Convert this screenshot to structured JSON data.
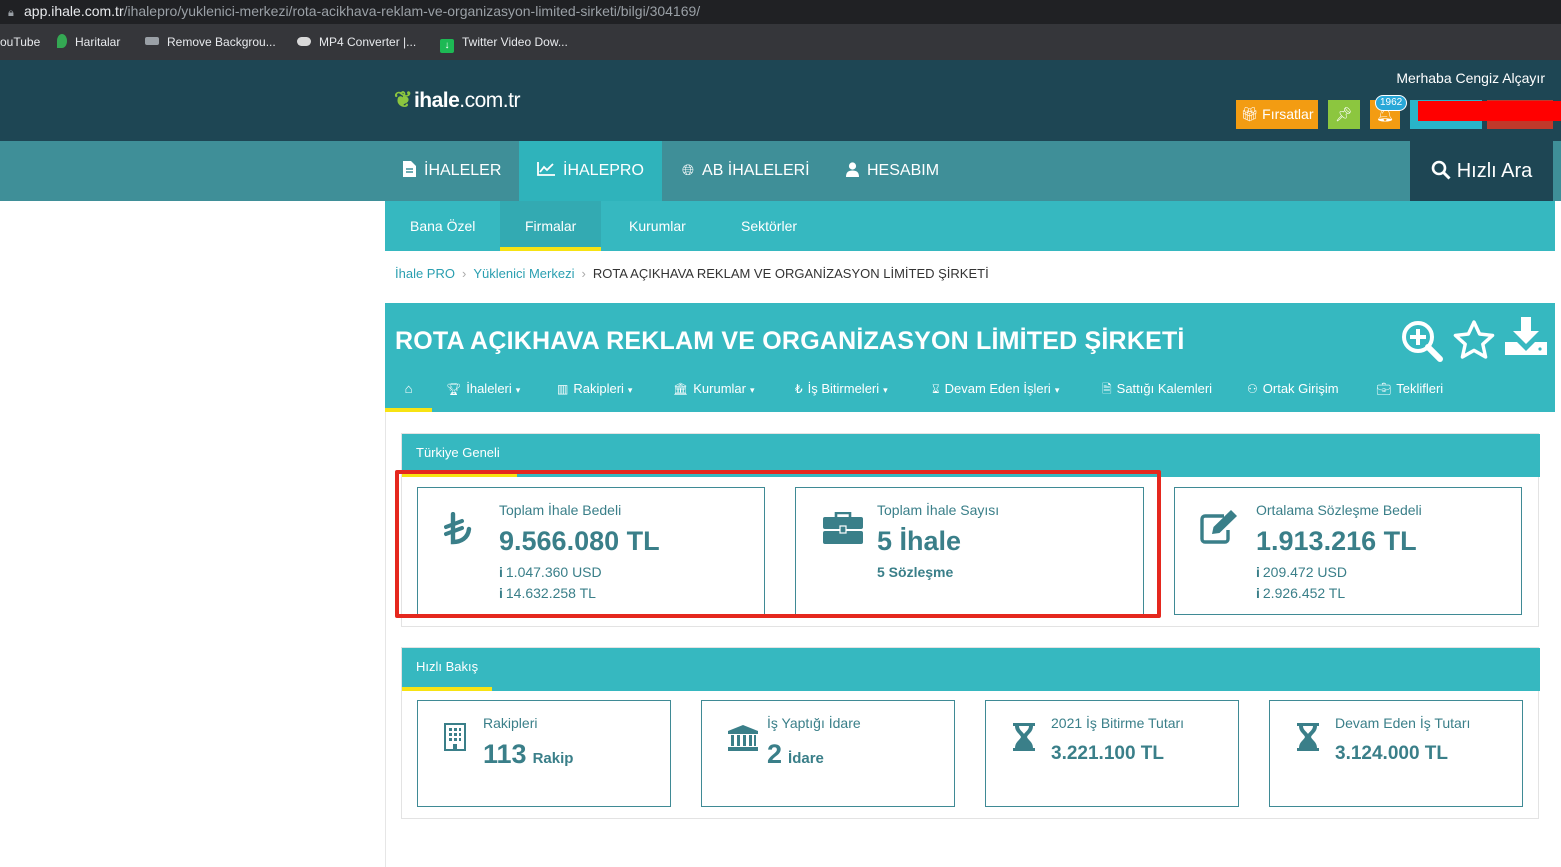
{
  "browser": {
    "url_host": "app.ihale.com.tr",
    "url_path": "/ihalepro/yuklenici-merkezi/rota-acikhava-reklam-ve-organizasyon-limited-sirketi/bilgi/304169/",
    "bookmarks": [
      "ouTube",
      "Haritalar",
      "Remove Backgrou...",
      "MP4 Converter |...",
      "Twitter Video Dow..."
    ]
  },
  "header": {
    "logo_main": "ihale",
    "logo_domain": ".com.tr",
    "greeting": "Merhaba Cengiz Alçayır",
    "firsatlar_label": "Fırsatlar",
    "notification_count": "1962"
  },
  "main_nav": {
    "items": [
      {
        "label": "İHALELER",
        "icon": "document-icon"
      },
      {
        "label": "İHALEPRO",
        "icon": "chart-line-icon"
      },
      {
        "label": "AB İHALELERİ",
        "icon": "globe-icon"
      },
      {
        "label": "HESABIM",
        "icon": "user-icon"
      }
    ],
    "active_index": 1,
    "quick_search_label": "Hızlı Ara"
  },
  "sub_nav": {
    "items": [
      "Bana Özel",
      "Firmalar",
      "Kurumlar",
      "Sektörler"
    ],
    "active_index": 1
  },
  "breadcrumb": {
    "items": [
      "İhale PRO",
      "Yüklenici Merkezi",
      "ROTA AÇIKHAVA REKLAM VE ORGANİZASYON LİMİTED ŞİRKETİ"
    ]
  },
  "company": {
    "title": "ROTA AÇIKHAVA REKLAM VE ORGANİZASYON LİMİTED ŞİRKETİ",
    "tabs": [
      {
        "label": "",
        "icon": "home-icon"
      },
      {
        "label": "İhaleleri",
        "icon": "trophy-icon",
        "dropdown": true
      },
      {
        "label": "Rakipleri",
        "icon": "building-icon",
        "dropdown": true
      },
      {
        "label": "Kurumlar",
        "icon": "institution-icon",
        "dropdown": true
      },
      {
        "label": "İş Bitirmeleri",
        "icon": "lira-icon",
        "dropdown": true
      },
      {
        "label": "Devam Eden İşleri",
        "icon": "hourglass-icon",
        "dropdown": true
      },
      {
        "label": "Sattığı Kalemleri",
        "icon": "file-icon",
        "dropdown": false
      },
      {
        "label": "Ortak Girişim",
        "icon": "users-icon",
        "dropdown": false
      },
      {
        "label": "Teklifleri",
        "icon": "briefcase-icon",
        "dropdown": false
      }
    ]
  },
  "turkiye_geneli": {
    "title": "Türkiye Geneli",
    "cards": [
      {
        "label": "Toplam İhale Bedeli",
        "value": "9.566.080 TL",
        "sub1": "1.047.360 USD",
        "sub2": "14.632.258 TL",
        "icon": "lira-icon"
      },
      {
        "label": "Toplam İhale Sayısı",
        "value": "5 İhale",
        "sub1": "5 Sözleşme",
        "icon": "briefcase-icon"
      },
      {
        "label": "Ortalama Sözleşme Bedeli",
        "value": "1.913.216 TL",
        "sub1": "209.472 USD",
        "sub2": "2.926.452 TL",
        "icon": "edit-icon"
      }
    ]
  },
  "hizli_bakis": {
    "title": "Hızlı Bakış",
    "cards": [
      {
        "label": "Rakipleri",
        "value": "113",
        "unit": "Rakip",
        "icon": "building-icon"
      },
      {
        "label": "İş Yaptığı İdare",
        "value": "2",
        "unit": "İdare",
        "icon": "institution-icon"
      },
      {
        "label": "2021 İş Bitirme Tutarı",
        "value": "3.221.100 TL",
        "icon": "hourglass-icon"
      },
      {
        "label": "Devam Eden İş Tutarı",
        "value": "3.124.000 TL",
        "icon": "hourglass-icon"
      }
    ]
  },
  "colors": {
    "header": "#1e4654",
    "nav": "#3f8f98",
    "teal": "#36b8c0",
    "accent_yellow": "#f7e313",
    "highlight_red": "#e5281e",
    "card_text": "#3a7f89"
  }
}
